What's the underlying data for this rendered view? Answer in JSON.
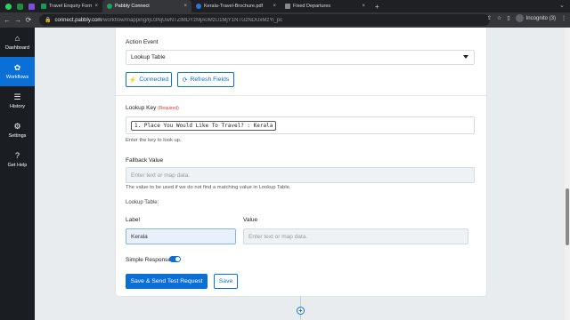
{
  "browser": {
    "tabs": [
      {
        "title": "Travel Enquiry Form (Response",
        "favicon_color": "#0f9d58"
      },
      {
        "title": "Pabbly Connect",
        "favicon_color": "#1aa260"
      },
      {
        "title": "Kerala-Travel-Brochure.pdf",
        "favicon_color": "#2b74d8"
      },
      {
        "title": "Fixed Departures",
        "favicon_color": "#888888"
      }
    ],
    "close_glyph": "×",
    "new_tab_glyph": "+",
    "tab_dropdown_glyph": "⌄",
    "url_host": "connect.pabbly.com",
    "url_path": "/workflow/mapping/IjU3NjUwNTZlMDYzMjA0MzU1MjY1NTUzNDUxMzYi_pc",
    "profile_label": "Incognito (3)",
    "back_glyph": "←",
    "forward_glyph": "→",
    "reload_glyph": "⟳",
    "lock_glyph": "🔒",
    "share_glyph": "⇪",
    "star_glyph": "☆",
    "sidepanel_glyph": "▯",
    "menu_glyph": "⋮"
  },
  "sidebar": {
    "items": [
      {
        "label": "Dashboard",
        "icon": "home-icon",
        "glyph": "⌂"
      },
      {
        "label": "Workflows",
        "icon": "workflows-icon",
        "glyph": "✿"
      },
      {
        "label": "History",
        "icon": "history-icon",
        "glyph": "☰"
      },
      {
        "label": "Settings",
        "icon": "gear-icon",
        "glyph": "⚙"
      },
      {
        "label": "Get Help",
        "icon": "help-icon",
        "glyph": "?"
      }
    ]
  },
  "form": {
    "action_event_label": "Action Event",
    "action_event_value": "Lookup Table",
    "connected_label": "Connected",
    "connected_glyph": "⚡",
    "refresh_label": "Refresh Fields",
    "refresh_glyph": "⟳",
    "lookup_key_label": "Lookup Key",
    "required_label": "(Required)",
    "lookup_key_value": "1. Place You Would Like To Travel? : Kerala",
    "lookup_key_help": "Enter the key to look up.",
    "fallback_label": "Fallback Value",
    "fallback_placeholder": "Enter text or map data.",
    "fallback_help": "The value to be used if we do not find a matching value in Lookup Table.",
    "lookup_table_label": "Lookup Table:",
    "col_label": "Label",
    "col_value": "Value",
    "row_label_value": "Kerala",
    "row_value_placeholder": "Enter text or map data.",
    "simple_response_label": "Simple Response",
    "simple_response_on": true,
    "save_send_label": "Save & Send Test Request",
    "save_label": "Save"
  },
  "add_step_glyph": "+",
  "colors": {
    "accent": "#0b6fd8",
    "sidebar_bg": "#1a1d21",
    "required": "#e53935"
  }
}
